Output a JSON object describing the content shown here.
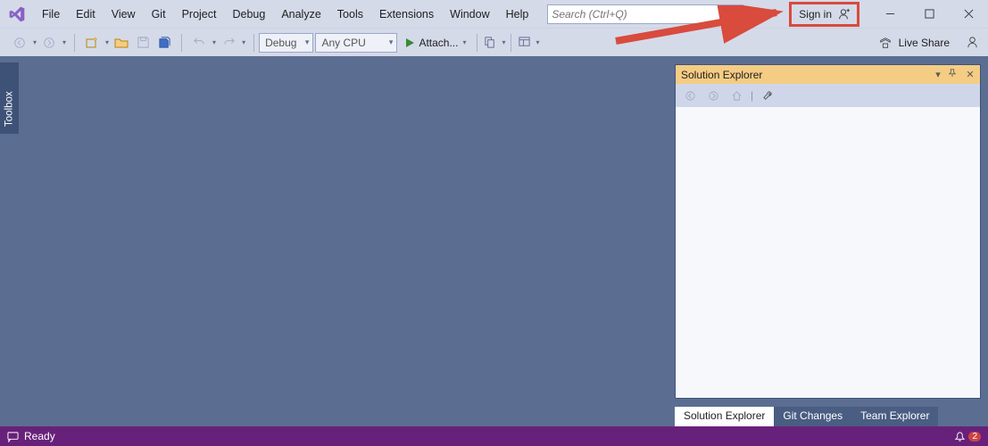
{
  "menu": {
    "items": [
      "File",
      "Edit",
      "View",
      "Git",
      "Project",
      "Debug",
      "Analyze",
      "Tools",
      "Extensions",
      "Window",
      "Help"
    ],
    "search_placeholder": "Search (Ctrl+Q)",
    "signin": "Sign in"
  },
  "toolbar": {
    "config": "Debug",
    "platform": "Any CPU",
    "attach": "Attach...",
    "liveshare": "Live Share"
  },
  "toolbox": {
    "label": "Toolbox"
  },
  "solution": {
    "title": "Solution Explorer",
    "tabs": [
      "Solution Explorer",
      "Git Changes",
      "Team Explorer"
    ],
    "active_tab": 0
  },
  "status": {
    "text": "Ready",
    "notif_count": "2"
  }
}
